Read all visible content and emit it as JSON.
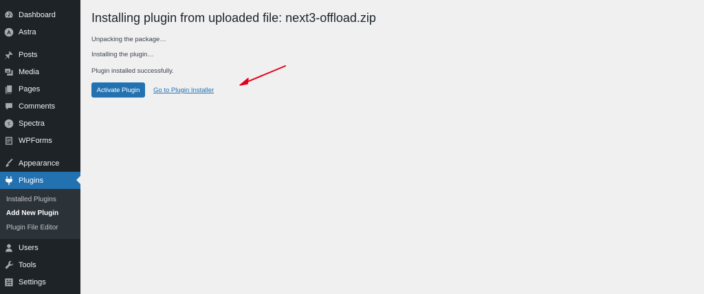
{
  "sidebar": {
    "items": [
      {
        "label": "Dashboard",
        "icon": "dashboard-icon"
      },
      {
        "label": "Astra",
        "icon": "astra-icon"
      },
      {
        "label": "Posts",
        "icon": "pin-icon"
      },
      {
        "label": "Media",
        "icon": "media-icon"
      },
      {
        "label": "Pages",
        "icon": "pages-icon"
      },
      {
        "label": "Comments",
        "icon": "comments-icon"
      },
      {
        "label": "Spectra",
        "icon": "spectra-icon"
      },
      {
        "label": "WPForms",
        "icon": "wpforms-icon"
      },
      {
        "label": "Appearance",
        "icon": "brush-icon"
      },
      {
        "label": "Plugins",
        "icon": "plug-icon"
      },
      {
        "label": "Users",
        "icon": "users-icon"
      },
      {
        "label": "Tools",
        "icon": "wrench-icon"
      },
      {
        "label": "Settings",
        "icon": "settings-icon"
      }
    ],
    "submenu": [
      {
        "label": "Installed Plugins"
      },
      {
        "label": "Add New Plugin"
      },
      {
        "label": "Plugin File Editor"
      }
    ]
  },
  "main": {
    "title": "Installing plugin from uploaded file: next3-offload.zip",
    "log": [
      "Unpacking the package…",
      "Installing the plugin…",
      "Plugin installed successfully."
    ],
    "activate_label": "Activate Plugin",
    "installer_link": "Go to Plugin Installer"
  },
  "colors": {
    "sidebar_bg": "#1d2327",
    "accent": "#2271b1",
    "annotation_arrow": "#e3001b"
  }
}
